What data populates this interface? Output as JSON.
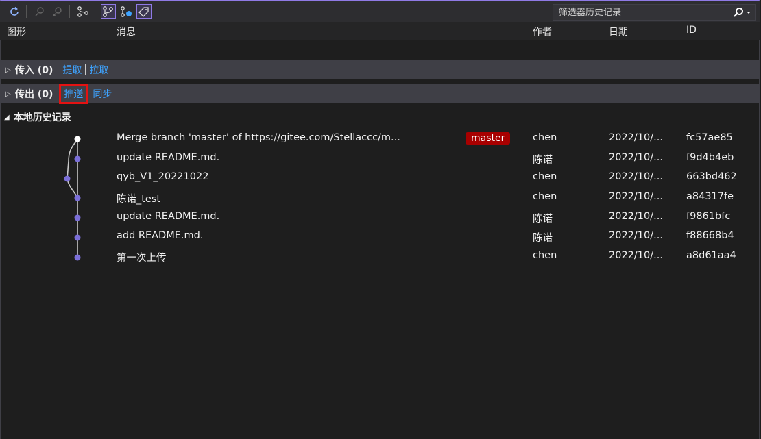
{
  "search": {
    "placeholder": "筛选器历史记录"
  },
  "toolbar": {
    "icons": [
      "refresh-icon",
      "fetch-icon",
      "pull-icon",
      "branch-icon",
      "graph-icon",
      "branch-remote-icon",
      "tag-icon",
      "search-icon",
      "dropdown-icon"
    ]
  },
  "columns": {
    "graph": "图形",
    "message": "消息",
    "author": "作者",
    "date": "日期",
    "id": "ID"
  },
  "incoming": {
    "label": "传入 (0)",
    "fetch": "提取",
    "pull": "拉取"
  },
  "outgoing": {
    "label": "传出 (0)",
    "push": "推送",
    "sync": "同步"
  },
  "local": {
    "label": "本地历史记录"
  },
  "commits": [
    {
      "message": "Merge branch 'master' of https://gitee.com/Stellaccc/m...",
      "badge": "master",
      "author": "chen",
      "date": "2022/10/...",
      "id": "fc57ae85"
    },
    {
      "message": "update README.md.",
      "author": "陈诺",
      "date": "2022/10/...",
      "id": "f9d4b4eb"
    },
    {
      "message": "qyb_V1_20221022",
      "author": "chen",
      "date": "2022/10/...",
      "id": "663bd462"
    },
    {
      "message": "陈诺_test",
      "author": "chen",
      "date": "2022/10/...",
      "id": "a84317fe"
    },
    {
      "message": "update README.md.",
      "author": "陈诺",
      "date": "2022/10/...",
      "id": "f9861bfc"
    },
    {
      "message": "add README.md.",
      "author": "陈诺",
      "date": "2022/10/...",
      "id": "f88668b4"
    },
    {
      "message": "第一次上传",
      "author": "chen",
      "date": "2022/10/...",
      "id": "a8d61aa4"
    }
  ],
  "colors": {
    "accent": "#8f7ae5",
    "link": "#3ea3ff",
    "badge": "#a80000",
    "highlight": "#e31212"
  }
}
